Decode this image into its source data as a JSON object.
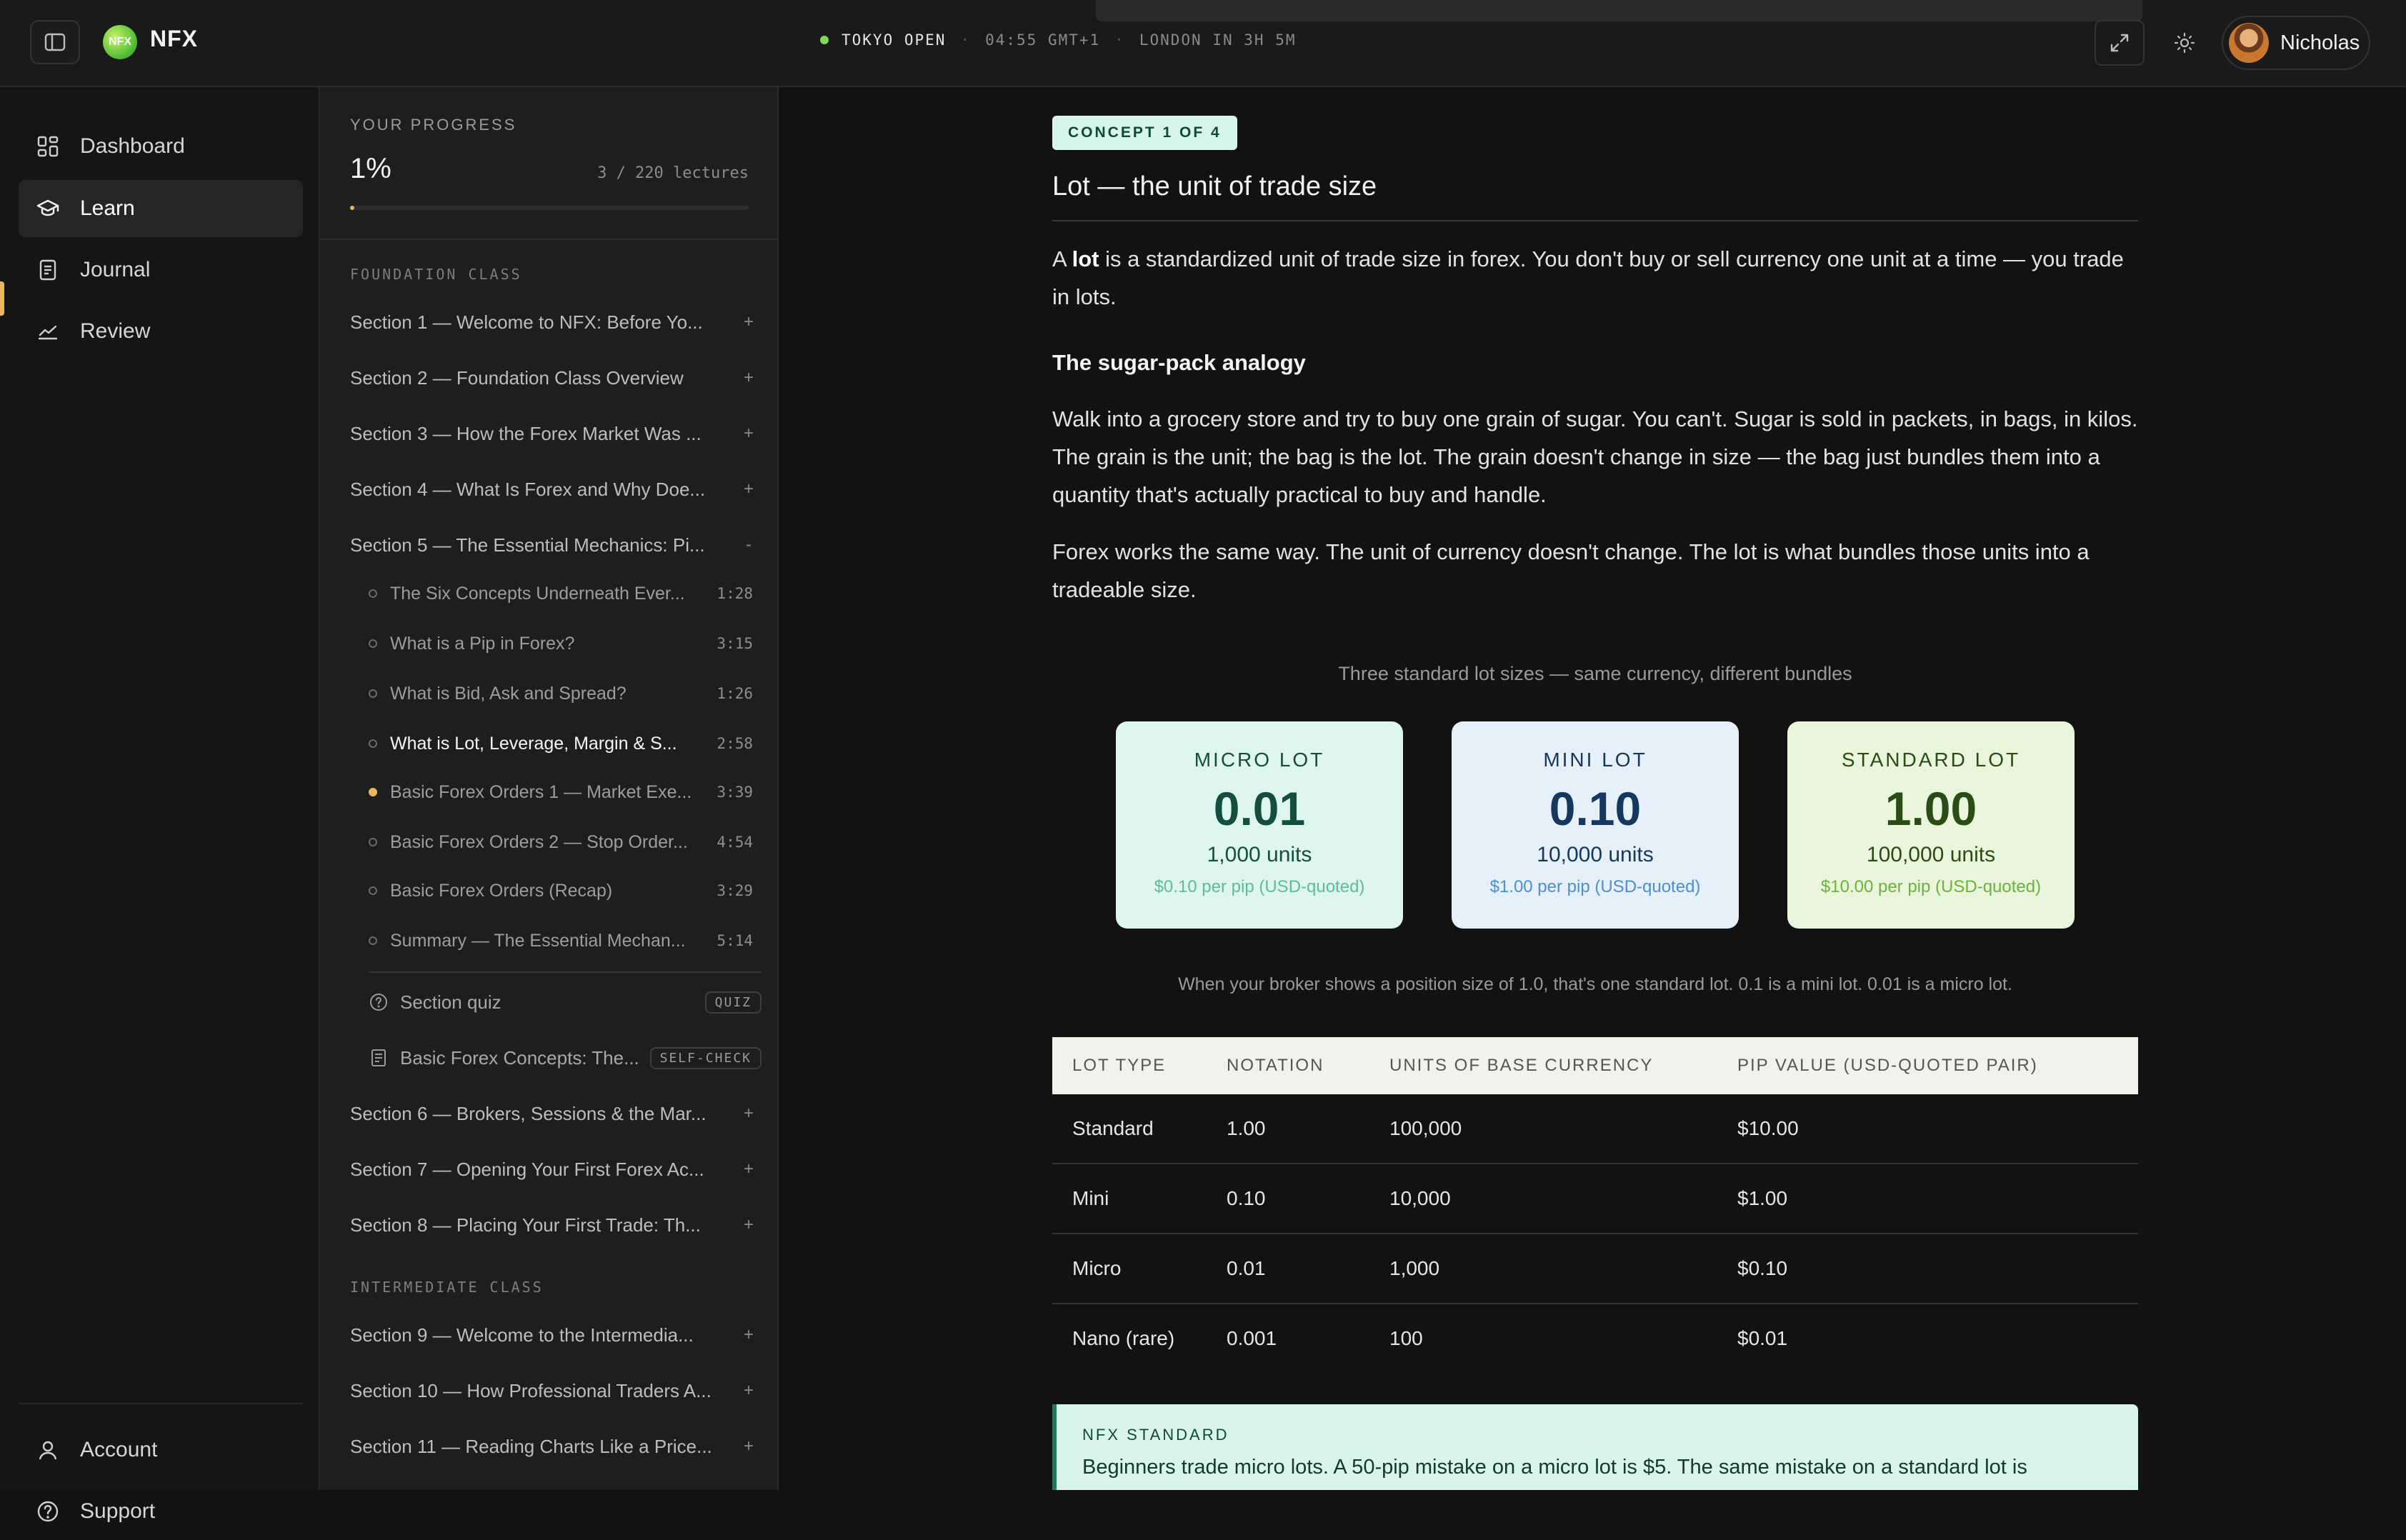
{
  "brand": {
    "name": "NFX",
    "logo_text": "NFX"
  },
  "market_status": {
    "session": "TOKYO OPEN",
    "time": "04:55 GMT+1",
    "next": "LONDON IN 3H 5M",
    "color": "#7ed957"
  },
  "user": {
    "name": "Nicholas"
  },
  "nav": {
    "items": [
      {
        "label": "Dashboard",
        "icon": "grid-icon"
      },
      {
        "label": "Learn",
        "icon": "graduation-cap-icon"
      },
      {
        "label": "Journal",
        "icon": "notebook-icon"
      },
      {
        "label": "Review",
        "icon": "trend-chart-icon"
      }
    ],
    "bottom": [
      {
        "label": "Account",
        "icon": "user-icon"
      },
      {
        "label": "Support",
        "icon": "help-circle-icon"
      }
    ]
  },
  "progress": {
    "label": "YOUR PROGRESS",
    "percent": "1%",
    "count": "3 / 220 lectures",
    "fill_fraction": 0.01,
    "accent": "#e7b75a"
  },
  "course": {
    "foundation_label": "FOUNDATION CLASS",
    "intermediate_label": "INTERMEDIATE CLASS",
    "sections_a": [
      {
        "title": "Section 1 — Welcome to NFX: Before Yo...",
        "toggle": "+"
      },
      {
        "title": "Section 2 — Foundation Class Overview",
        "toggle": "+"
      },
      {
        "title": "Section 3 — How the Forex Market Was ...",
        "toggle": "+"
      },
      {
        "title": "Section 4 — What Is Forex and Why Doe...",
        "toggle": "+"
      },
      {
        "title": "Section 5 — The Essential Mechanics: Pi...",
        "toggle": "-"
      }
    ],
    "lectures": [
      {
        "title": "The Six Concepts Underneath Ever...",
        "duration": "1:28"
      },
      {
        "title": "What is a Pip in Forex?",
        "duration": "3:15"
      },
      {
        "title": "What is Bid, Ask and Spread?",
        "duration": "1:26"
      },
      {
        "title": "What is Lot, Leverage, Margin & S...",
        "duration": "2:58"
      },
      {
        "title": "Basic Forex Orders 1 — Market Exe...",
        "duration": "3:39"
      },
      {
        "title": "Basic Forex Orders 2 — Stop Order...",
        "duration": "4:54"
      },
      {
        "title": "Basic Forex Orders (Recap)",
        "duration": "3:29"
      },
      {
        "title": "Summary — The Essential Mechan...",
        "duration": "5:14"
      }
    ],
    "quiz": {
      "title": "Section quiz",
      "tag": "QUIZ"
    },
    "selfcheck": {
      "title": "Basic Forex Concepts: The...",
      "tag": "SELF-CHECK"
    },
    "sections_b": [
      {
        "title": "Section 6 — Brokers, Sessions & the Mar...",
        "toggle": "+"
      },
      {
        "title": "Section 7 — Opening Your First Forex Ac...",
        "toggle": "+"
      },
      {
        "title": "Section 8 — Placing Your First Trade: Th...",
        "toggle": "+"
      }
    ],
    "sections_c": [
      {
        "title": "Section 9 — Welcome to the Intermedia...",
        "toggle": "+"
      },
      {
        "title": "Section 10 — How Professional Traders A...",
        "toggle": "+"
      },
      {
        "title": "Section 11 — Reading Charts Like a Price...",
        "toggle": "+"
      }
    ]
  },
  "lesson": {
    "concept_tag": "CONCEPT 1 OF 4",
    "title": "Lot — the unit of trade size",
    "intro_a": "A ",
    "intro_bold": "lot",
    "intro_b": " is a standardized unit of trade size in forex. You don't buy or sell currency one unit at a time — you trade in lots.",
    "subheading": "The sugar-pack analogy",
    "para2": "Walk into a grocery store and try to buy one grain of sugar. You can't. Sugar is sold in packets, in bags, in kilos. The grain is the unit; the bag is the lot. The grain doesn't change in size — the bag just bundles them into a quantity that's actually practical to buy and handle.",
    "para3": "Forex works the same way. The unit of currency doesn't change. The lot is what bundles those units into a tradeable size.",
    "lots_caption": "Three standard lot sizes — same currency, different bundles",
    "lots": [
      {
        "name": "MICRO LOT",
        "value": "0.01",
        "units": "1,000 units",
        "pip": "$0.10 per pip (USD-quoted)",
        "bg": "#dff6ee",
        "fg": "#134e3e",
        "sub": "#5dbba0"
      },
      {
        "name": "MINI LOT",
        "value": "0.10",
        "units": "10,000 units",
        "pip": "$1.00 per pip (USD-quoted)",
        "bg": "#e5f0fb",
        "fg": "#17385e",
        "sub": "#4d8fd1"
      },
      {
        "name": "STANDARD LOT",
        "value": "1.00",
        "units": "100,000 units",
        "pip": "$10.00 per pip (USD-quoted)",
        "bg": "#e9f6dc",
        "fg": "#2a4d16",
        "sub": "#6db13f"
      }
    ],
    "lots_note": "When your broker shows a position size of 1.0, that's one standard lot. 0.1 is a mini lot. 0.01 is a micro lot.",
    "table": {
      "headers": [
        "LOT TYPE",
        "NOTATION",
        "UNITS OF BASE CURRENCY",
        "PIP VALUE (USD-QUOTED PAIR)"
      ],
      "rows": [
        [
          "Standard",
          "1.00",
          "100,000",
          "$10.00"
        ],
        [
          "Mini",
          "0.10",
          "10,000",
          "$1.00"
        ],
        [
          "Micro",
          "0.01",
          "1,000",
          "$0.10"
        ],
        [
          "Nano (rare)",
          "0.001",
          "100",
          "$0.01"
        ]
      ]
    },
    "callout": {
      "label": "NFX STANDARD",
      "text": "Beginners trade micro lots. A 50-pip mistake on a micro lot is $5. The same mistake on a standard lot is"
    }
  }
}
